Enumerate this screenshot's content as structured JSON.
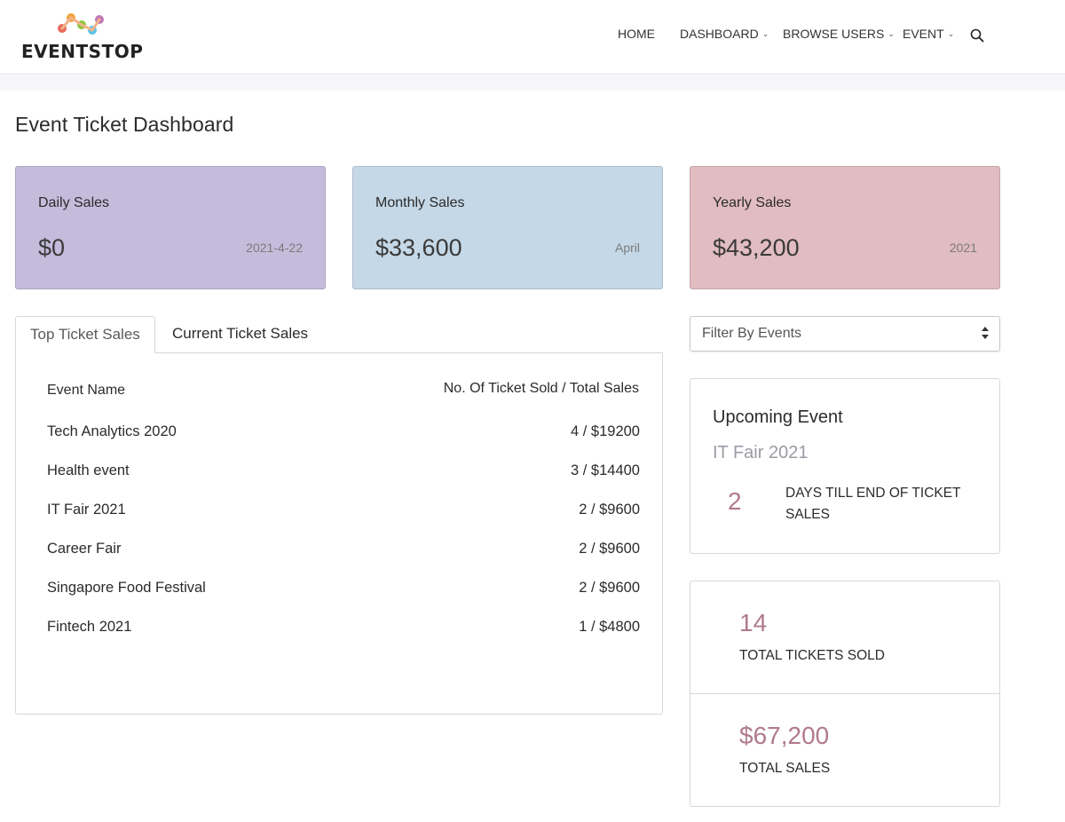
{
  "header": {
    "logo_text": "EVENTSTOP",
    "nav": [
      {
        "label": "HOME",
        "has_dropdown": false
      },
      {
        "label": "DASHBOARD",
        "has_dropdown": true
      },
      {
        "label": "BROWSE USERS",
        "has_dropdown": true
      },
      {
        "label": "EVENT",
        "has_dropdown": true
      }
    ],
    "search_icon": "search-icon"
  },
  "page": {
    "title": "Event Ticket Dashboard"
  },
  "cards": {
    "daily": {
      "title": "Daily Sales",
      "value": "$0",
      "meta": "2021-4-22",
      "color": "#c5bcdc"
    },
    "monthly": {
      "title": "Monthly Sales",
      "value": "$33,600",
      "meta": "April",
      "color": "#c5d8e7"
    },
    "yearly": {
      "title": "Yearly Sales",
      "value": "$43,200",
      "meta": "2021",
      "color": "#e1bcc0"
    }
  },
  "tabs": [
    {
      "label": "Top Ticket Sales",
      "active": true
    },
    {
      "label": "Current Ticket Sales",
      "active": false
    }
  ],
  "table": {
    "headers": {
      "name": "Event Name",
      "sold": "No. Of Ticket Sold / Total Sales"
    },
    "rows": [
      {
        "name": "Tech Analytics 2020",
        "value": "4 / $19200"
      },
      {
        "name": "Health event",
        "value": "3 / $14400"
      },
      {
        "name": "IT Fair 2021",
        "value": "2 / $9600"
      },
      {
        "name": "Career Fair",
        "value": "2 / $9600"
      },
      {
        "name": "Singapore Food Festival",
        "value": "2 / $9600"
      },
      {
        "name": "Fintech 2021",
        "value": "1 / $4800"
      }
    ]
  },
  "filter": {
    "selected": "Filter By Events"
  },
  "upcoming": {
    "title": "Upcoming Event",
    "event": "IT Fair 2021",
    "days": "2",
    "days_label": "DAYS TILL END OF TICKET SALES"
  },
  "totals": {
    "tickets_value": "14",
    "tickets_label": "TOTAL TICKETS SOLD",
    "sales_value": "$67,200",
    "sales_label": "TOTAL SALES"
  },
  "colors": {
    "accent_number": "#b07a8c",
    "muted_event": "#9b9ba5"
  }
}
